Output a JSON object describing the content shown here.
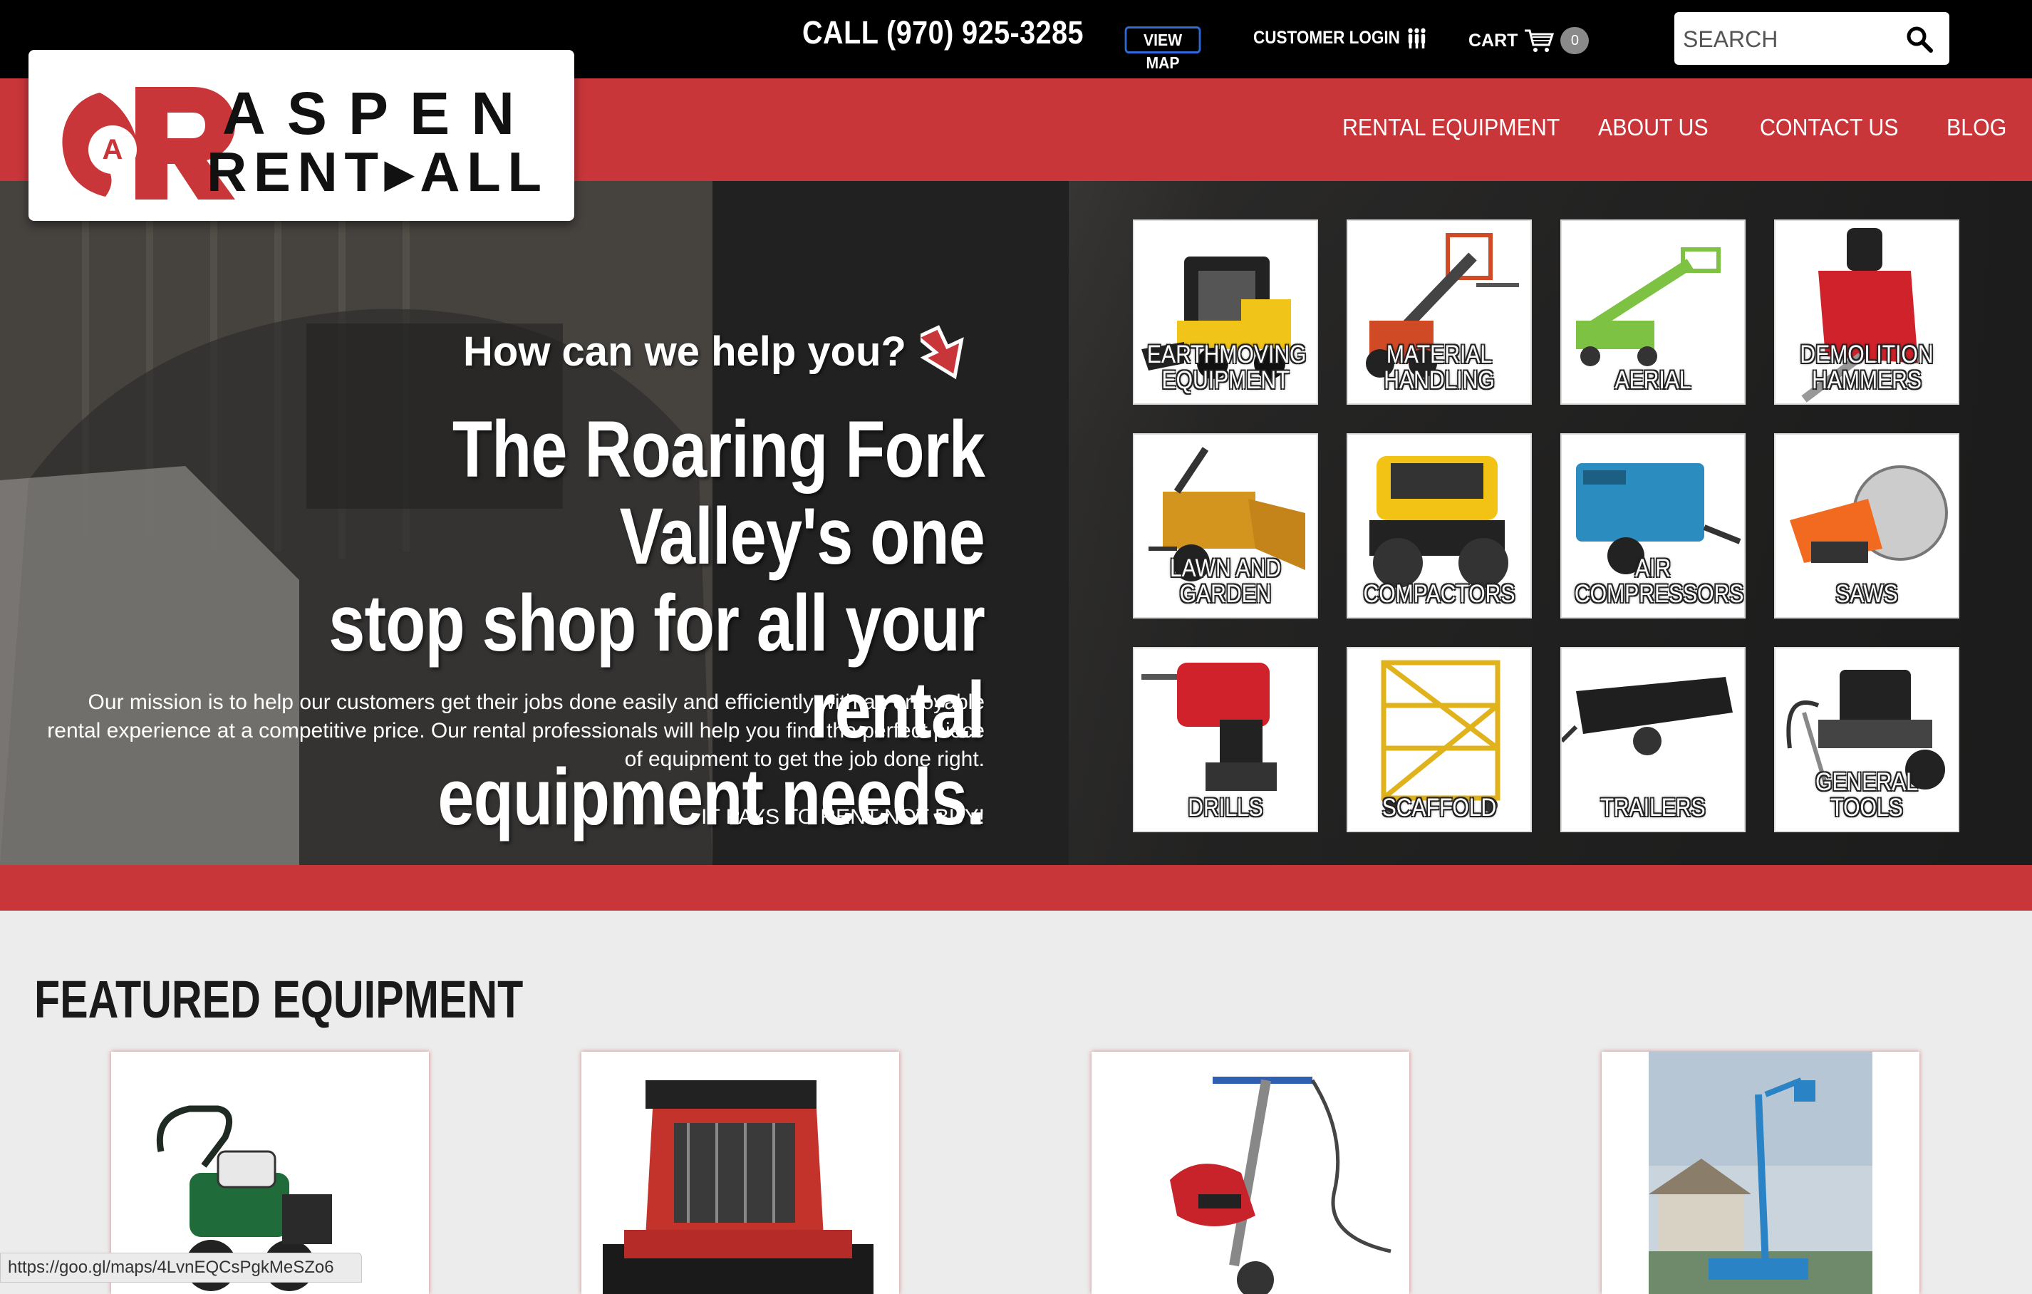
{
  "header": {
    "phone": "CALL (970) 925-3285",
    "view_map": "VIEW MAP",
    "customer_login": "CUSTOMER LOGIN",
    "cart_label": "CART",
    "cart_count": "0",
    "search_placeholder": "SEARCH"
  },
  "logo": {
    "line1": "ASPEN",
    "line2": "RENT▸ALL",
    "brand_color": "#c8363a"
  },
  "nav": {
    "items": [
      "RENTAL EQUIPMENT",
      "ABOUT US",
      "CONTACT US",
      "BLOG"
    ]
  },
  "hero": {
    "question": "How can we help you?",
    "headline_1": "The Roaring Fork Valley's one",
    "headline_2": "stop shop for all your rental",
    "headline_3": "equipment needs.",
    "mission": "Our mission is to help our customers get their jobs done easily and efficiently with an enjoyable rental experience at a competitive price. Our rental professionals will help you find the perfect piece of equipment to get the job done right.",
    "tagline": "IT PAYS TO RENT NOT BUY!"
  },
  "categories": [
    {
      "line1": "EARTHMOVING",
      "line2": "EQUIPMENT",
      "icon": "skid-steer-icon"
    },
    {
      "line1": "MATERIAL",
      "line2": "HANDLING",
      "icon": "telehandler-icon"
    },
    {
      "line1": "",
      "line2": "AERIAL",
      "icon": "boom-lift-icon"
    },
    {
      "line1": "DEMOLITION",
      "line2": "HAMMERS",
      "icon": "breaker-icon"
    },
    {
      "line1": "LAWN AND",
      "line2": "GARDEN",
      "icon": "chipper-icon"
    },
    {
      "line1": "",
      "line2": "COMPACTORS",
      "icon": "compactor-icon"
    },
    {
      "line1": "AIR",
      "line2": "COMPRESSORS",
      "icon": "compressor-icon"
    },
    {
      "line1": "",
      "line2": "SAWS",
      "icon": "saw-icon"
    },
    {
      "line1": "",
      "line2": "DRILLS",
      "icon": "drill-icon"
    },
    {
      "line1": "",
      "line2": "SCAFFOLD",
      "icon": "scaffold-icon"
    },
    {
      "line1": "",
      "line2": "TRAILERS",
      "icon": "trailer-icon"
    },
    {
      "line1": "",
      "line2": "GENERAL TOOLS",
      "icon": "pressure-washer-icon"
    }
  ],
  "featured": {
    "title": "FEATURED EQUIPMENT",
    "items": [
      {
        "icon": "aerator-icon"
      },
      {
        "icon": "track-loader-icon"
      },
      {
        "icon": "floor-scraper-icon"
      },
      {
        "icon": "lift-photo-icon"
      }
    ]
  },
  "status_url": "https://goo.gl/maps/4LvnEQCsPgkMeSZo6",
  "colors": {
    "accent": "#c8363a",
    "top_bar": "#000000",
    "view_map_border": "#2f6bd8"
  }
}
